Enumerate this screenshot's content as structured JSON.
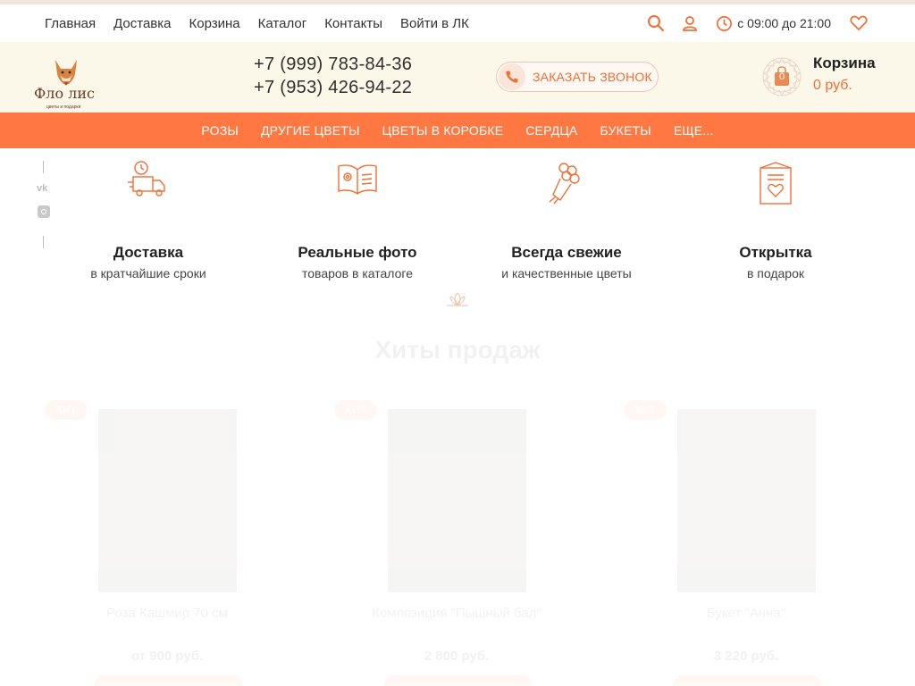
{
  "topnav": {
    "links": [
      "Главная",
      "Доставка",
      "Корзина",
      "Каталог",
      "Контакты",
      "Войти в ЛК"
    ],
    "hours": "с 09:00 до 21:00",
    "icons": [
      "search-icon",
      "user-icon",
      "clock-icon",
      "heart-icon"
    ]
  },
  "header": {
    "logo": {
      "name": "Фло лис",
      "tagline": "цветы и подарки"
    },
    "phones": [
      "+7 (999) 783-84-36",
      "+7 (953) 426-94-22"
    ],
    "callback_label": "ЗАКАЗАТЬ ЗВОНОК",
    "cart": {
      "title": "Корзина",
      "sum": "0 руб.",
      "count": "0"
    }
  },
  "categories": [
    "РОЗЫ",
    "ДРУГИЕ ЦВЕТЫ",
    "ЦВЕТЫ В КОРОБКЕ",
    "СЕРДЦА",
    "БУКЕТЫ",
    "ЕЩЕ..."
  ],
  "social": [
    "vk-icon",
    "instagram-icon"
  ],
  "features": [
    {
      "title": "Доставка",
      "subtitle": "в кратчайшие сроки",
      "icon": "delivery-truck-icon"
    },
    {
      "title": "Реальные фото",
      "subtitle": "товаров в каталоге",
      "icon": "photo-book-icon"
    },
    {
      "title": "Всегда свежие",
      "subtitle": "и качественные цветы",
      "icon": "bouquet-icon"
    },
    {
      "title": "Открытка",
      "subtitle": "в подарок",
      "icon": "greeting-card-icon"
    }
  ],
  "hits": {
    "title": "Хиты продаж",
    "products": [
      {
        "badge": "ХИТ",
        "name": "Роза Кашмир 70 см",
        "price": "от 900 руб."
      },
      {
        "badge": "ХИТ",
        "name": "Композиция \"Пышный бал\"",
        "price": "2 800 руб."
      },
      {
        "badge": "ХИТ",
        "name": "Букет \"Анна\"",
        "price": "3 220 руб."
      }
    ]
  },
  "colors": {
    "accent": "#ff7842",
    "header_bg": "#fcf8e9",
    "text": "#333333"
  }
}
